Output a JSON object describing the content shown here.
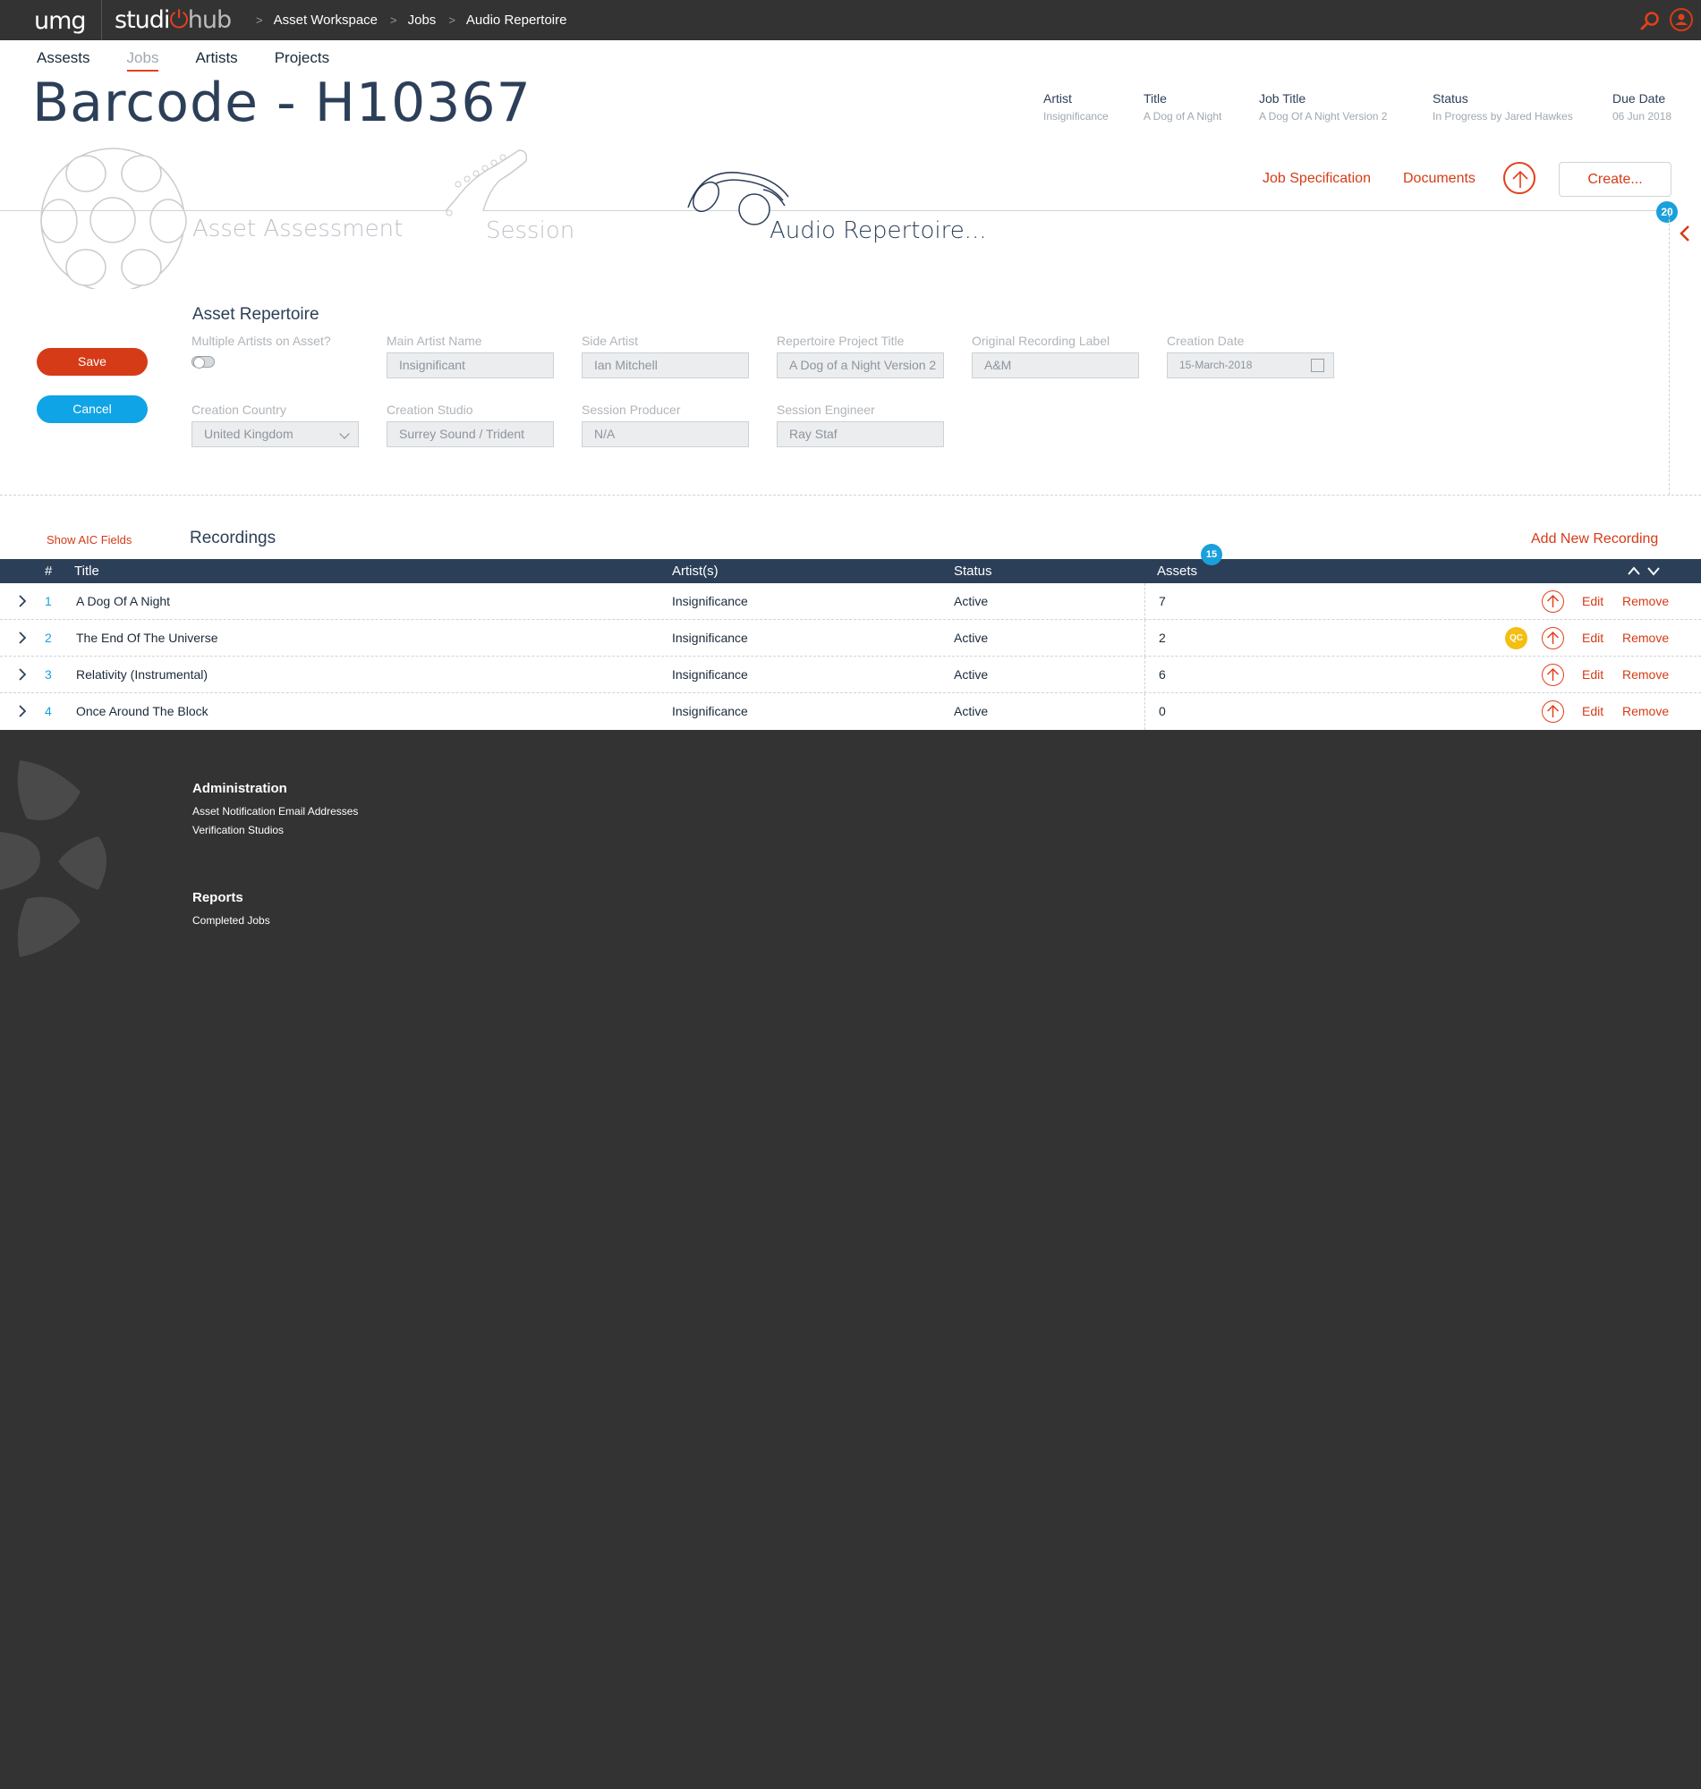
{
  "topbar": {
    "logo_umg": "umg",
    "logo_studio": "studi",
    "logo_hub": "hub",
    "breadcrumbs": [
      "Asset Workspace",
      "Jobs",
      "Audio Repertoire"
    ],
    "crumb_sep": ">"
  },
  "nav": {
    "items": [
      "Assests",
      "Jobs",
      "Artists",
      "Projects"
    ],
    "active": "Jobs"
  },
  "header": {
    "title": "Barcode - H10367",
    "meta": [
      {
        "label": "Artist",
        "value": "Insignificance"
      },
      {
        "label": "Title",
        "value": "A Dog of A Night"
      },
      {
        "label": "Job Title",
        "value": "A Dog Of A Night Version 2"
      },
      {
        "label": "Status",
        "value": "In Progress by Jared Hawkes"
      },
      {
        "label": "Due Date",
        "value": "06 Jun 2018"
      }
    ]
  },
  "steps": [
    "Asset Assessment",
    "Session",
    "Audio Repertoire..."
  ],
  "actions": {
    "job_spec": "Job Specification",
    "documents": "Documents",
    "create": "Create...",
    "panel_badge": "20"
  },
  "form": {
    "title": "Asset Repertoire",
    "save": "Save",
    "cancel": "Cancel",
    "multiple_artists_label": "Multiple Artists on Asset?",
    "fields": [
      {
        "label": "Main Artist Name",
        "value": "Insignificant"
      },
      {
        "label": "Side Artist",
        "value": "Ian Mitchell"
      },
      {
        "label": "Repertoire Project Title",
        "value": "A Dog of a Night Version 2"
      },
      {
        "label": "Original Recording Label",
        "value": "A&M"
      },
      {
        "label": "Creation Date",
        "value": "15-March-2018"
      },
      {
        "label": "Creation Country",
        "value": "United Kingdom"
      },
      {
        "label": "Creation Studio",
        "value": "Surrey Sound / Trident"
      },
      {
        "label": "Session Producer",
        "value": "N/A"
      },
      {
        "label": "Session Engineer",
        "value": "Ray Staf"
      }
    ]
  },
  "recordings": {
    "show_aic": "Show AIC Fields",
    "title": "Recordings",
    "add": "Add New Recording",
    "assets_badge": "15",
    "columns": [
      "#",
      "Title",
      "Artist(s)",
      "Status",
      "Assets"
    ],
    "rows": [
      {
        "num": "1",
        "title": "A Dog Of A Night",
        "artist": "Insignificance",
        "status": "Active",
        "assets": "7",
        "qc": ""
      },
      {
        "num": "2",
        "title": "The End Of The Universe",
        "artist": "Insignificance",
        "status": "Active",
        "assets": "2",
        "qc": "QC"
      },
      {
        "num": "3",
        "title": "Relativity (Instrumental)",
        "artist": "Insignificance",
        "status": "Active",
        "assets": "6",
        "qc": ""
      },
      {
        "num": "4",
        "title": "Once Around The Block",
        "artist": "Insignificance",
        "status": "Active",
        "assets": "0",
        "qc": ""
      }
    ],
    "edit": "Edit",
    "remove": "Remove"
  },
  "footer": {
    "admin_title": "Administration",
    "admin_links": [
      "Asset Notification Email Addresses",
      "Verification Studios"
    ],
    "reports_title": "Reports",
    "reports_links": [
      "Completed Jobs"
    ]
  },
  "colors": {
    "accent": "#d53b17",
    "info": "#1aa0dc",
    "header_bar": "#2c3f58",
    "chrome": "#333333"
  }
}
